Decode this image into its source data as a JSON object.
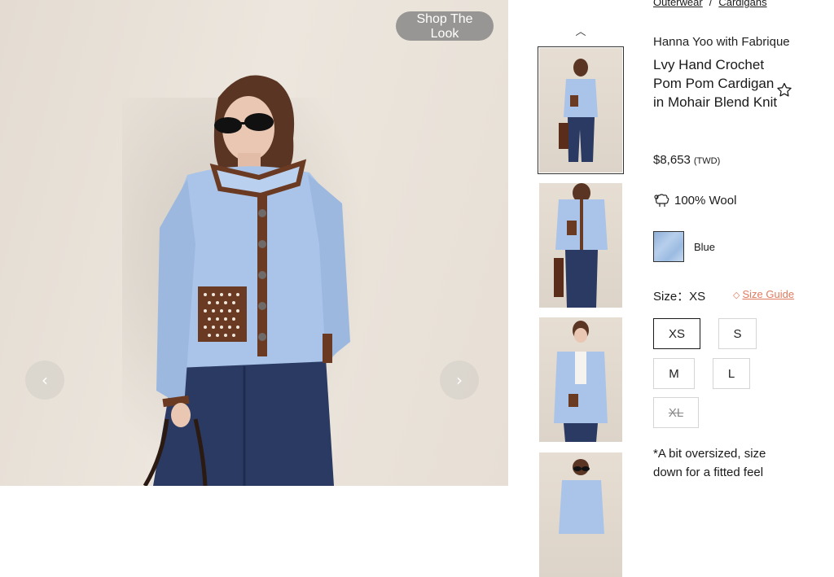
{
  "gallery": {
    "shop_look_label": "Shop The Look",
    "prev_label": "‹",
    "next_label": "›",
    "thumb_up_label": "︿",
    "colors": {
      "sweater": "#a9c4e8",
      "trim": "#6b3a22",
      "jeans": "#2a3a62",
      "skin": "#e9c7b2",
      "hair": "#5a3523"
    }
  },
  "breadcrumb": {
    "items": [
      "Outerwear",
      "Cardigans"
    ],
    "separator": "/"
  },
  "product": {
    "brand": "Hanna Yoo with Fabrique",
    "title": "Lvy Hand Crochet Pom Pom Cardigan in Mohair Blend Knit",
    "price": "$8,653",
    "currency": "(TWD)",
    "material": "100% Wool",
    "material_icon": "sheep-icon",
    "favorite_icon": "star-outline-icon"
  },
  "color": {
    "selected": "Blue",
    "swatch": "#a9c4e8"
  },
  "size": {
    "label": "Size：XS",
    "guide_label": "Size Guide",
    "guide_icon": "tag-icon",
    "accent": "#e07a5f",
    "options": [
      {
        "label": "XS",
        "state": "selected"
      },
      {
        "label": "S",
        "state": "available"
      },
      {
        "label": "M",
        "state": "available"
      },
      {
        "label": "L",
        "state": "available"
      },
      {
        "label": "XL",
        "state": "sold-out"
      }
    ]
  },
  "fit_note": "*A bit oversized, size down for a fitted feel"
}
